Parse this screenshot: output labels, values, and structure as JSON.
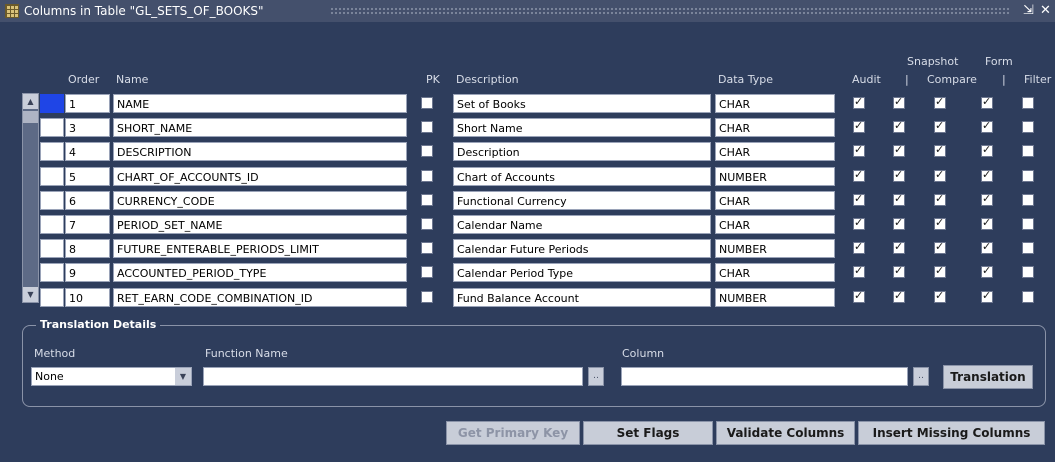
{
  "window": {
    "title": "Columns in Table \"GL_SETS_OF_BOOKS\"",
    "minimize_glyph": "⇲",
    "close_glyph": "✕"
  },
  "headers": {
    "order": "Order",
    "name": "Name",
    "pk": "PK",
    "description": "Description",
    "data_type": "Data Type",
    "snapshot": "Snapshot",
    "form": "Form",
    "audit": "Audit",
    "sep1": "|",
    "compare": "Compare",
    "sep2": "|",
    "filter": "Filter"
  },
  "rows": [
    {
      "order": "1",
      "name": "NAME",
      "pk": false,
      "description": "Set of Books",
      "data_type": "CHAR",
      "flags": [
        true,
        true,
        true,
        true,
        false
      ],
      "current": true
    },
    {
      "order": "3",
      "name": "SHORT_NAME",
      "pk": false,
      "description": "Short Name",
      "data_type": "CHAR",
      "flags": [
        true,
        true,
        true,
        true,
        false
      ],
      "current": false
    },
    {
      "order": "4",
      "name": "DESCRIPTION",
      "pk": false,
      "description": "Description",
      "data_type": "CHAR",
      "flags": [
        true,
        true,
        true,
        true,
        false
      ],
      "current": false
    },
    {
      "order": "5",
      "name": "CHART_OF_ACCOUNTS_ID",
      "pk": false,
      "description": "Chart of Accounts",
      "data_type": "NUMBER",
      "flags": [
        true,
        true,
        true,
        true,
        false
      ],
      "current": false
    },
    {
      "order": "6",
      "name": "CURRENCY_CODE",
      "pk": false,
      "description": "Functional Currency",
      "data_type": "CHAR",
      "flags": [
        true,
        true,
        true,
        true,
        false
      ],
      "current": false
    },
    {
      "order": "7",
      "name": "PERIOD_SET_NAME",
      "pk": false,
      "description": "Calendar Name",
      "data_type": "CHAR",
      "flags": [
        true,
        true,
        true,
        true,
        false
      ],
      "current": false
    },
    {
      "order": "8",
      "name": "FUTURE_ENTERABLE_PERIODS_LIMIT",
      "pk": false,
      "description": "Calendar Future Periods",
      "data_type": "NUMBER",
      "flags": [
        true,
        true,
        true,
        true,
        false
      ],
      "current": false
    },
    {
      "order": "9",
      "name": "ACCOUNTED_PERIOD_TYPE",
      "pk": false,
      "description": "Calendar Period Type",
      "data_type": "CHAR",
      "flags": [
        true,
        true,
        true,
        true,
        false
      ],
      "current": false
    },
    {
      "order": "10",
      "name": "RET_EARN_CODE_COMBINATION_ID",
      "pk": false,
      "description": "Fund Balance Account",
      "data_type": "NUMBER",
      "flags": [
        true,
        true,
        true,
        true,
        false
      ],
      "current": false
    }
  ],
  "translation": {
    "title": "Translation Details",
    "method_label": "Method",
    "method_value": "None",
    "function_label": "Function Name",
    "function_value": "",
    "column_label": "Column",
    "column_value": "",
    "translation_button": "Translation"
  },
  "buttons": {
    "get_primary_key": "Get Primary Key",
    "set_flags": "Set Flags",
    "validate_columns": "Validate Columns",
    "insert_missing_columns": "Insert Missing Columns"
  },
  "colors": {
    "background": "#2e3d5c",
    "title_bar": "#44506c",
    "current_record": "#1f45e6"
  }
}
